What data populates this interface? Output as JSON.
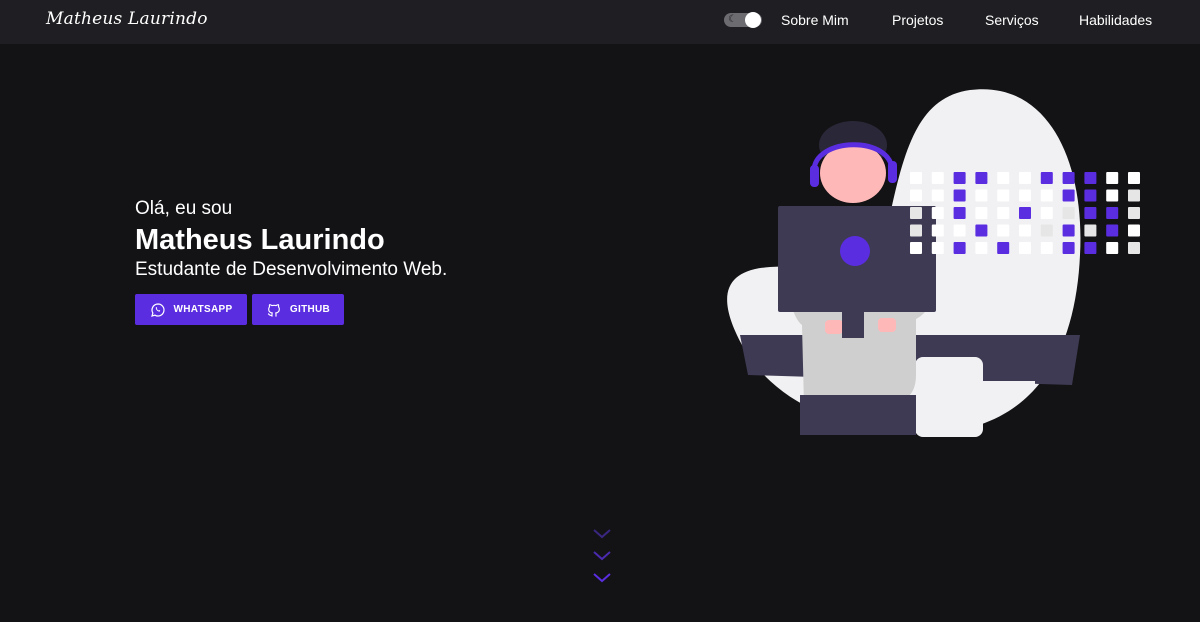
{
  "header": {
    "logo": "Matheus Laurindo",
    "nav": {
      "sobre": "Sobre Mim",
      "projetos": "Projetos",
      "servicos": "Serviços",
      "habilidades": "Habilidades"
    }
  },
  "hero": {
    "greeting": "Olá, eu sou",
    "name": "Matheus Laurindo",
    "role": "Estudante de Desenvolvimento Web.",
    "buttons": {
      "whatsapp": "WHATSAPP",
      "github": "GITHUB"
    }
  },
  "icons": {
    "theme_toggle": "moon-icon",
    "whatsapp": "whatsapp-icon",
    "github": "github-icon",
    "scroll": "chevron-down-icon"
  },
  "colors": {
    "accent": "#5b2de1",
    "background": "#131215",
    "header": "#1f1e22"
  }
}
